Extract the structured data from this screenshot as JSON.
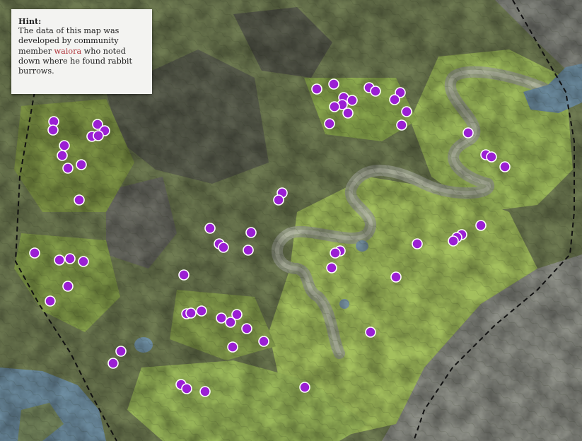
{
  "hint": {
    "title": "Hint:",
    "text_before": "The data of this map was developed by community member ",
    "link_text": "waiora",
    "text_after": " who noted down where he found rabbit burrows."
  },
  "colors": {
    "marker_fill": "#9b1fd4",
    "marker_stroke": "#ffffff",
    "link": "#b0343b",
    "water": "#6f8fa3",
    "lowland": "#a7c45c",
    "mountain": "#8b8d85",
    "boundary": "#111111"
  },
  "icons": {
    "marker": "rabbit-burrow-marker-icon"
  }
}
